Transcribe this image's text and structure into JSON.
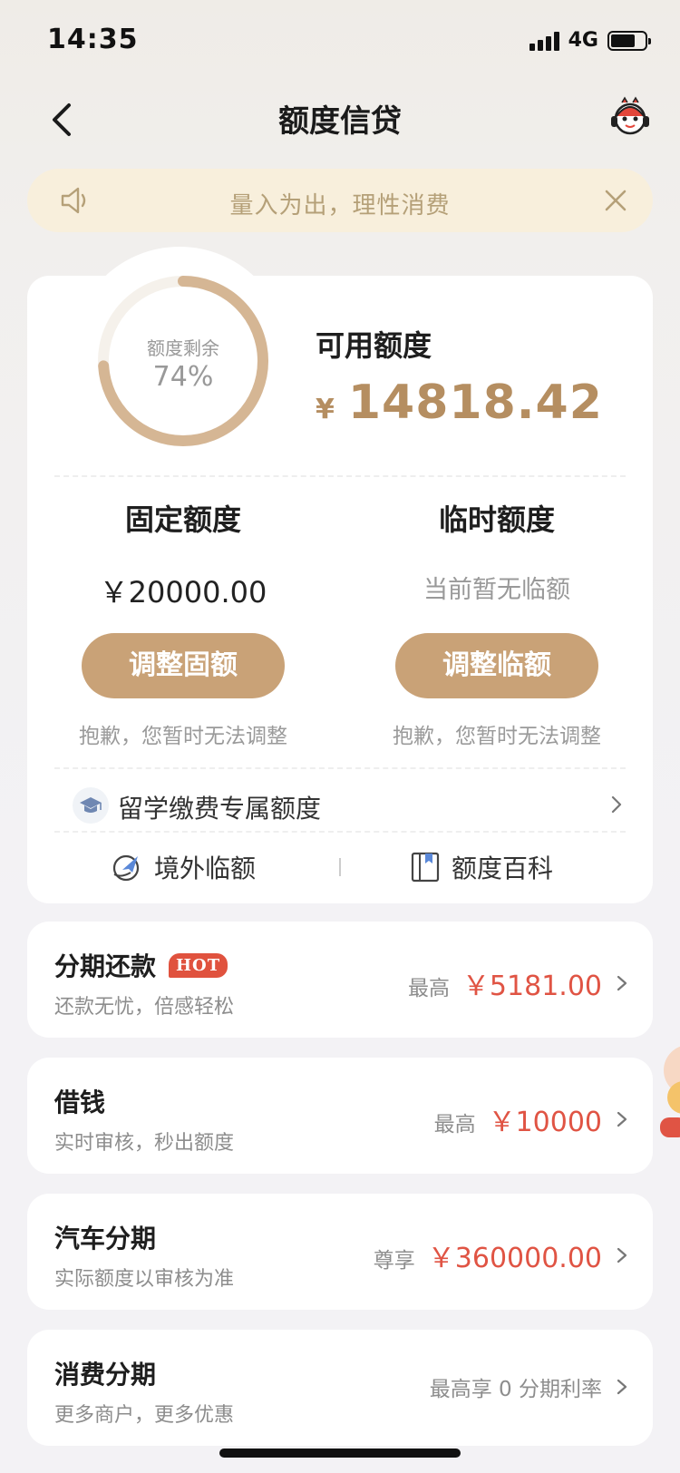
{
  "status": {
    "time": "14:35",
    "network": "4G",
    "battery_fraction": 0.72
  },
  "nav": {
    "title": "额度信贷",
    "back_icon": "chevron-left-icon",
    "service_icon": "customer-service-icon"
  },
  "notice": {
    "text": "量入为出，理性消费",
    "icon": "speaker-icon"
  },
  "summary": {
    "remaining_label": "额度剩余",
    "remaining_percent": "74%",
    "remaining_fraction": 0.74,
    "available_label": "可用额度",
    "currency": "¥",
    "available_amount": "14818.42",
    "ring_color": "#c9a277"
  },
  "fixed": {
    "label": "固定额度",
    "value": "￥20000.00",
    "button": "调整固额",
    "note": "抱歉，您暂时无法调整"
  },
  "temporary": {
    "label": "临时额度",
    "value": "当前暂无临额",
    "button": "调整临额",
    "note": "抱歉，您暂时无法调整"
  },
  "study_row": {
    "label": "留学缴费专属额度",
    "icon": "graduation-cap-icon"
  },
  "links": [
    {
      "label": "境外临额",
      "icon": "plane-globe-icon"
    },
    {
      "label": "额度百科",
      "icon": "book-icon"
    }
  ],
  "products": [
    {
      "title": "分期还款",
      "badge": "HOT",
      "subtitle": "还款无忧，倍感轻松",
      "prefix": "最高",
      "amount": "￥5181.00"
    },
    {
      "title": "借钱",
      "subtitle": "实时审核，秒出额度",
      "prefix": "最高",
      "amount": "￥10000"
    },
    {
      "title": "汽车分期",
      "subtitle": "实际额度以审核为准",
      "prefix": "尊享",
      "amount": "￥360000.00"
    },
    {
      "title": "消费分期",
      "subtitle": "更多商户，更多优惠",
      "prefix": "最高享 0 分期利率",
      "amount": ""
    }
  ],
  "colors": {
    "accent_gold": "#c9a277",
    "amount_gold": "#b58e61",
    "amount_red": "#e05444",
    "hot_badge": "#e0523e"
  }
}
